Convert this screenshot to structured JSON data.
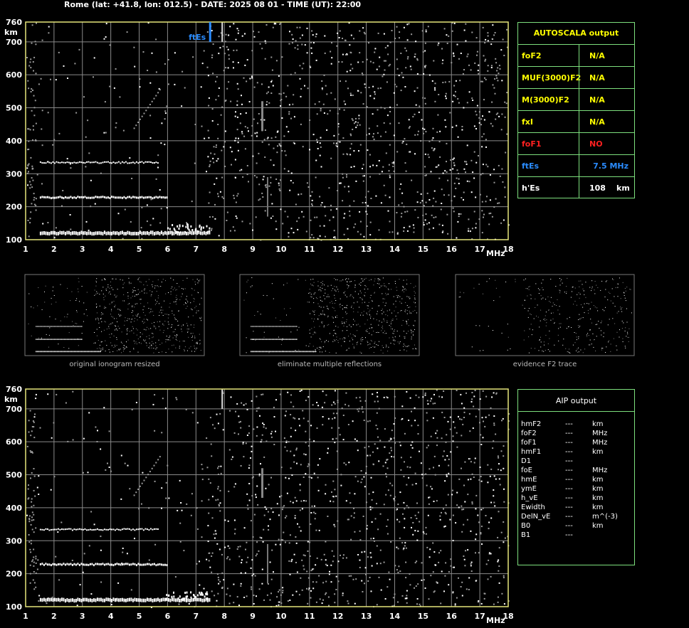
{
  "header": {
    "title": "Rome (lat: +41.8, lon: 012.5) - DATE: 2025 08 01 - TIME (UT): 22:00"
  },
  "colors": {
    "frame": "#e6e67a",
    "grid": "#8a8a8a",
    "table_border": "#7ddf7d",
    "yellow": "#ffff00",
    "red": "#ff2020",
    "blue": "#2a8cff",
    "trace": "#ffffff"
  },
  "chart_data": [
    {
      "type": "scatter",
      "name_role": "autoscala ionogram",
      "xlabel": "MHz",
      "ylabel": "km",
      "xlim": [
        1,
        18
      ],
      "ylim": [
        100,
        760
      ],
      "xticks": [
        1,
        2,
        3,
        4,
        5,
        6,
        7,
        8,
        9,
        10,
        11,
        12,
        13,
        14,
        15,
        16,
        17,
        18
      ],
      "yticks": [
        100,
        200,
        300,
        400,
        500,
        600,
        700,
        760
      ],
      "grid": true,
      "annotation": {
        "text": "ftEs",
        "x": 7.5,
        "y_from": 700,
        "y_to": 760
      },
      "traces": [
        {
          "label": "Es trace",
          "x_from": 1.5,
          "x_to": 7.5,
          "y": 120
        },
        {
          "label": "2nd reflection",
          "x_from": 1.5,
          "x_to": 6.0,
          "y": 228
        },
        {
          "label": "3rd reflection",
          "x_from": 1.5,
          "x_to": 5.7,
          "y": 334
        }
      ]
    },
    {
      "type": "scatter",
      "name_role": "aip ionogram",
      "xlabel": "MHz",
      "ylabel": "km",
      "xlim": [
        1,
        18
      ],
      "ylim": [
        100,
        760
      ],
      "xticks": [
        1,
        2,
        3,
        4,
        5,
        6,
        7,
        8,
        9,
        10,
        11,
        12,
        13,
        14,
        15,
        16,
        17,
        18
      ],
      "yticks": [
        100,
        200,
        300,
        400,
        500,
        600,
        700,
        760
      ],
      "grid": true
    }
  ],
  "thumbnails": [
    {
      "caption": "original ionogram resized"
    },
    {
      "caption": "eliminate multiple reflections"
    },
    {
      "caption": "evidence F2 trace"
    }
  ],
  "autoscala": {
    "title": "AUTOSCALA output",
    "rows": [
      {
        "name": "foF2",
        "value": "N/A",
        "unit": "",
        "color": "yellow"
      },
      {
        "name": "MUF(3000)F2",
        "value": "N/A",
        "unit": "",
        "color": "yellow"
      },
      {
        "name": "M(3000)F2",
        "value": "N/A",
        "unit": "",
        "color": "yellow"
      },
      {
        "name": "fxI",
        "value": "N/A",
        "unit": "",
        "color": "yellow"
      },
      {
        "name": "foF1",
        "value": "NO",
        "unit": "",
        "color": "red"
      },
      {
        "name": "ftEs",
        "value": "7.5 MHz",
        "unit": "",
        "color": "blue"
      },
      {
        "name": "h'Es",
        "value": "108",
        "unit": "km",
        "color": "white"
      }
    ]
  },
  "aip": {
    "title": "AIP output",
    "rows": [
      {
        "name": "hmF2",
        "value": "---",
        "unit": "km"
      },
      {
        "name": "foF2",
        "value": "---",
        "unit": "MHz"
      },
      {
        "name": "foF1",
        "value": "---",
        "unit": "MHz"
      },
      {
        "name": "hmF1",
        "value": "---",
        "unit": "km"
      },
      {
        "name": "D1",
        "value": "---",
        "unit": ""
      },
      {
        "name": "foE",
        "value": "---",
        "unit": "MHz"
      },
      {
        "name": "hmE",
        "value": "---",
        "unit": "km"
      },
      {
        "name": "ymE",
        "value": "---",
        "unit": "km"
      },
      {
        "name": "h_vE",
        "value": "---",
        "unit": "km"
      },
      {
        "name": "Ewidth",
        "value": "---",
        "unit": "km"
      },
      {
        "name": "DelN_vE",
        "value": "---",
        "unit": "m^(-3)"
      },
      {
        "name": "B0",
        "value": "---",
        "unit": "km"
      },
      {
        "name": "B1",
        "value": "---",
        "unit": ""
      }
    ]
  }
}
